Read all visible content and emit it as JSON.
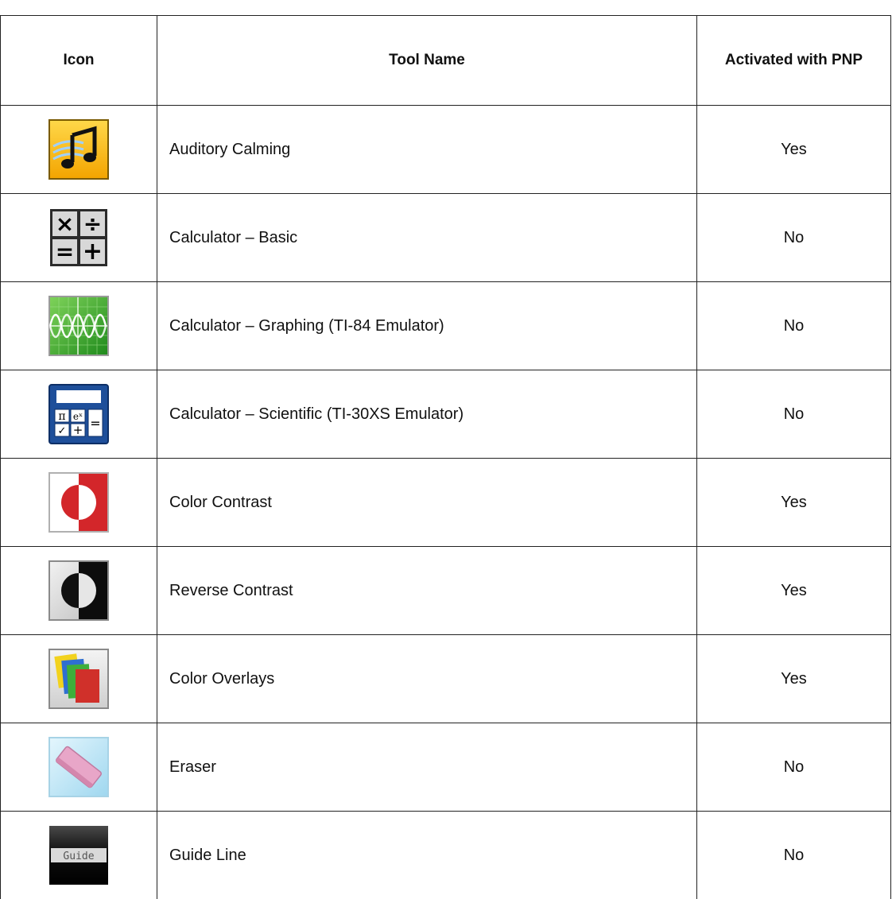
{
  "table": {
    "headers": {
      "icon": "Icon",
      "tool_name": "Tool Name",
      "activated": "Activated with PNP"
    },
    "rows": [
      {
        "icon": "music-note-icon",
        "tool_name": "Auditory Calming",
        "activated": "Yes"
      },
      {
        "icon": "basic-calculator-icon",
        "tool_name": "Calculator – Basic",
        "activated": "No"
      },
      {
        "icon": "graphing-calculator-icon",
        "tool_name": "Calculator – Graphing (TI-84 Emulator)",
        "activated": "No"
      },
      {
        "icon": "scientific-calculator-icon",
        "tool_name": "Calculator – Scientific (TI-30XS Emulator)",
        "activated": "No"
      },
      {
        "icon": "color-contrast-icon",
        "tool_name": "Color Contrast",
        "activated": "Yes"
      },
      {
        "icon": "reverse-contrast-icon",
        "tool_name": "Reverse Contrast",
        "activated": "Yes"
      },
      {
        "icon": "color-overlays-icon",
        "tool_name": "Color Overlays",
        "activated": "Yes"
      },
      {
        "icon": "eraser-icon",
        "tool_name": "Eraser",
        "activated": "No"
      },
      {
        "icon": "guide-line-icon",
        "tool_name": "Guide Line",
        "activated": "No"
      }
    ],
    "icon_text": {
      "scientific_pi": "π",
      "scientific_ex": "eˣ",
      "scientific_check": "✓",
      "scientific_plus": "+",
      "scientific_equals": "=",
      "basic_times": "×",
      "basic_divide": "÷",
      "basic_equals": "=",
      "basic_plus": "+",
      "guide_label": "Guide"
    },
    "colors": {
      "auditory_bg": "#f6b400",
      "graph_bg": "#3aa52a",
      "scientific_bg": "#1e4f9a",
      "contrast_red": "#d3262a",
      "overlay_red": "#d0302a",
      "overlay_blue": "#2f6fd0",
      "overlay_green": "#3fae3a",
      "overlay_yellow": "#f2d21e",
      "eraser_bg": "#bfe5f5",
      "eraser_pink": "#e8a6c8"
    }
  }
}
